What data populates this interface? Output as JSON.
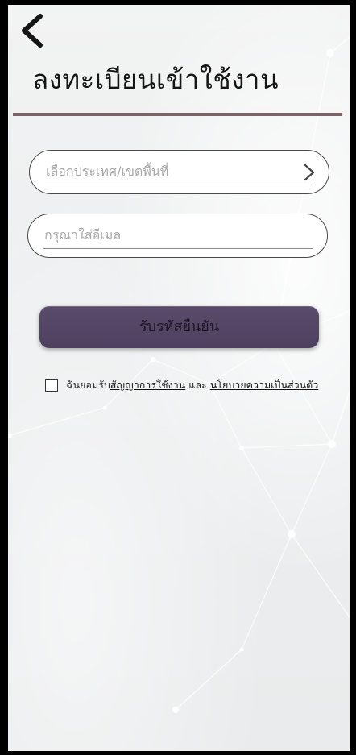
{
  "header": {
    "back_icon": "chevron-left-icon",
    "title": "ลงทะเบียนเข้าใช้งาน",
    "divider_color": "#7a6466"
  },
  "form": {
    "region_field": {
      "placeholder": "เลือกประเทศ/เขตพื้นที่",
      "icon": "chevron-right-icon"
    },
    "email_field": {
      "placeholder": "กรุณาใส่อีเมล",
      "value": ""
    },
    "confirm_button": {
      "label": "รับรหัสยืนยัน",
      "color": "#54456a"
    }
  },
  "agreement": {
    "checked": false,
    "prefix": "ฉันยอมรับ",
    "terms_link": "สัญญาการใช้งาน",
    "conjunction": "และ",
    "privacy_link": "นโยบายความเป็นส่วนตัว"
  }
}
